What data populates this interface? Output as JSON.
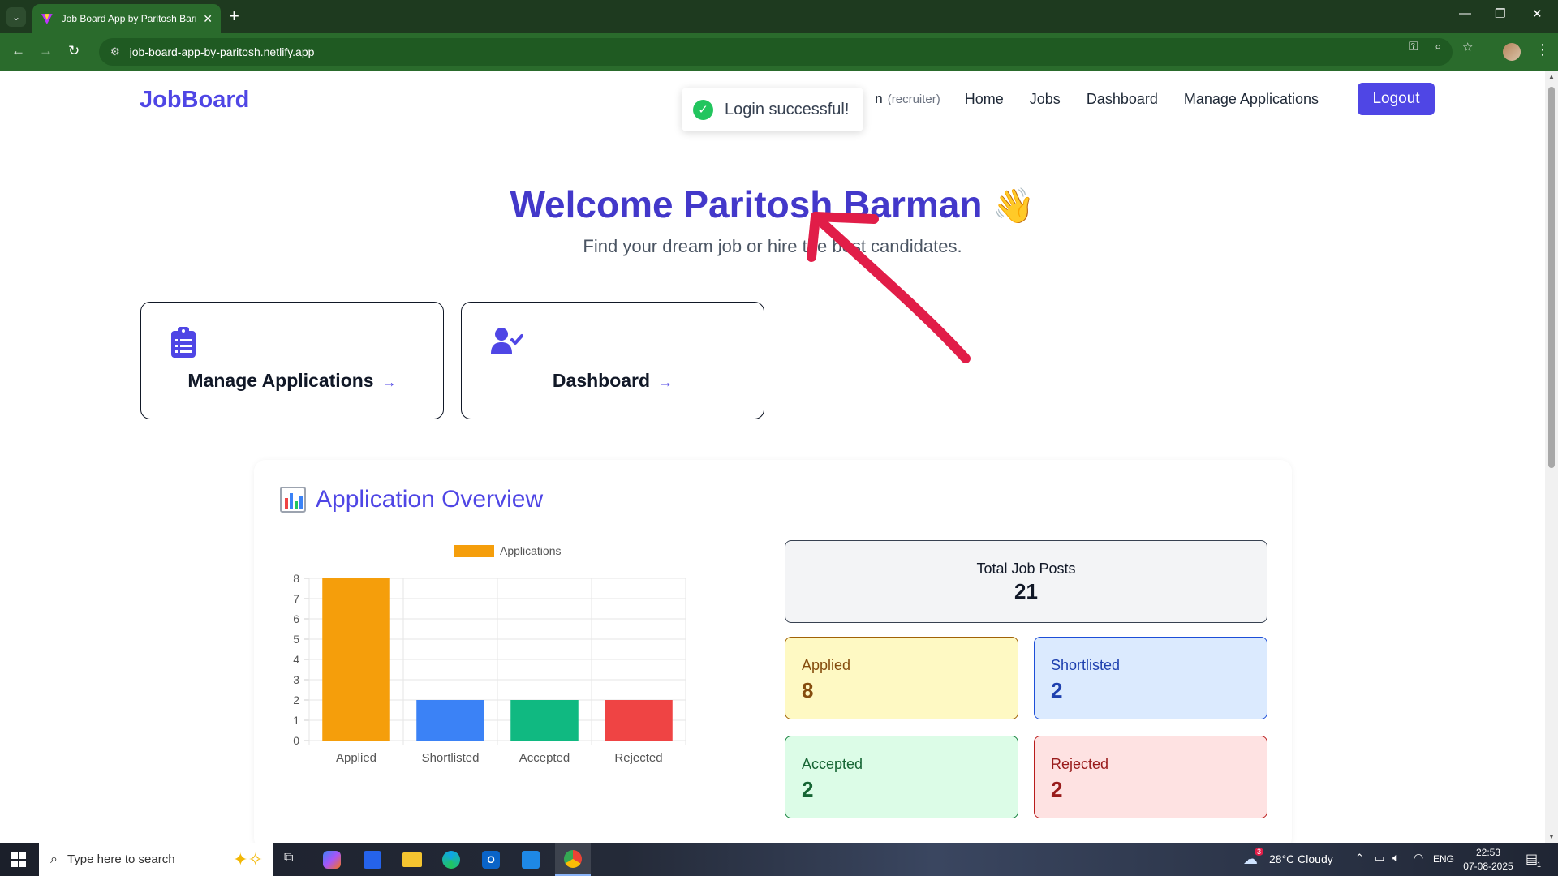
{
  "browser": {
    "tab_title": "Job Board App by Paritosh Barman",
    "url": "job-board-app-by-paritosh.netlify.app"
  },
  "header": {
    "brand": "JobBoard",
    "user_partial": "n",
    "role": "(recruiter)",
    "nav": [
      "Home",
      "Jobs",
      "Dashboard",
      "Manage Applications"
    ],
    "logout": "Logout"
  },
  "toast": {
    "message": "Login successful!"
  },
  "hero": {
    "title": "Welcome Paritosh Barman",
    "emoji": "👋",
    "subtitle": "Find your dream job or hire the best candidates."
  },
  "actions": [
    {
      "label": "Manage Applications",
      "arrow": "→",
      "icon": "clipboard-list-icon"
    },
    {
      "label": "Dashboard",
      "arrow": "→",
      "icon": "user-check-icon"
    }
  ],
  "overview": {
    "title": "Application Overview",
    "total_label": "Total Job Posts",
    "total_value": "21",
    "stats": [
      {
        "label": "Applied",
        "value": "8",
        "bg": "#fef9c3",
        "border": "#a16207",
        "color": "#854d0e"
      },
      {
        "label": "Shortlisted",
        "value": "2",
        "bg": "#dbeafe",
        "border": "#1d4ed8",
        "color": "#1e40af"
      },
      {
        "label": "Accepted",
        "value": "2",
        "bg": "#dcfce7",
        "border": "#15803d",
        "color": "#166534"
      },
      {
        "label": "Rejected",
        "value": "2",
        "bg": "#fee2e2",
        "border": "#b91c1c",
        "color": "#991b1b"
      }
    ]
  },
  "chart_data": {
    "type": "bar",
    "categories": [
      "Applied",
      "Shortlisted",
      "Accepted",
      "Rejected"
    ],
    "values": [
      8,
      2,
      2,
      2
    ],
    "colors": [
      "#f59e0b",
      "#3b82f6",
      "#10b981",
      "#ef4444"
    ],
    "legend": "Applications",
    "legend_color": "#f59e0b",
    "ylim": [
      0,
      8
    ],
    "yticks": [
      0,
      1,
      2,
      3,
      4,
      5,
      6,
      7,
      8
    ],
    "grid": true,
    "legend_position": "top"
  },
  "taskbar": {
    "search_placeholder": "Type here to search",
    "weather": "28°C Cloudy",
    "weather_badge": "3",
    "lang": "ENG",
    "time": "22:53",
    "date": "07-08-2025",
    "notification_count": "1"
  }
}
